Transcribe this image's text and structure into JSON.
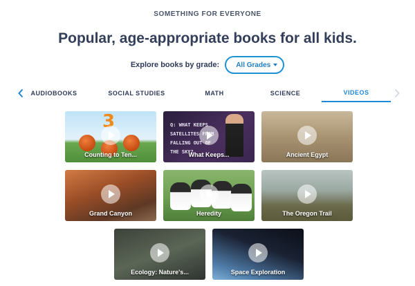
{
  "header": {
    "eyebrow": "SOMETHING FOR EVERYONE",
    "headline": "Popular, age-appropriate books for all kids."
  },
  "grade_filter": {
    "label": "Explore books by grade:",
    "selected": "All Grades"
  },
  "tabs": [
    {
      "label": "AUDIOBOOKS",
      "active": false
    },
    {
      "label": "SOCIAL STUDIES",
      "active": false
    },
    {
      "label": "MATH",
      "active": false
    },
    {
      "label": "SCIENCE",
      "active": false
    },
    {
      "label": "VIDEOS",
      "active": true
    }
  ],
  "videos": [
    {
      "title": "Counting to Ten...",
      "overlay_text": "3"
    },
    {
      "title": "What Keeps...",
      "overlay_text": "Q: WHAT KEEPS SATELLITES FROM FALLING OUT OF THE SKY?"
    },
    {
      "title": "Ancient Egypt"
    },
    {
      "title": "Grand Canyon"
    },
    {
      "title": "Heredity"
    },
    {
      "title": "The Oregon Trail"
    },
    {
      "title": "Ecology: Nature's..."
    },
    {
      "title": "Space Exploration"
    }
  ],
  "colors": {
    "accent": "#1e88d8",
    "heading": "#333e5a"
  },
  "icons": {
    "tabs_prev": "chevron-left-icon",
    "tabs_next": "chevron-right-icon",
    "play": "play-icon",
    "dropdown": "caret-down-icon"
  }
}
